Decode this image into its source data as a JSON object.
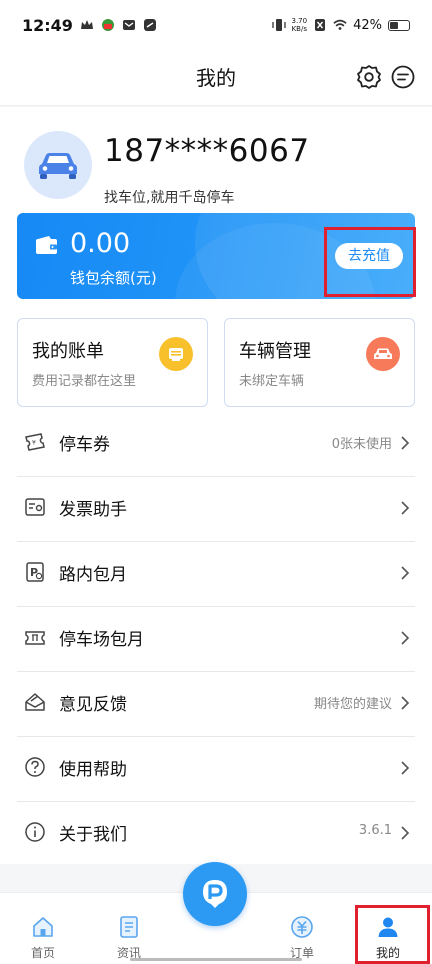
{
  "status_bar": {
    "time": "12:49",
    "net_speed_value": "3.70",
    "net_speed_unit": "KB/s",
    "battery": "42%"
  },
  "header": {
    "title": "我的",
    "settings_icon": "gear-icon",
    "message_icon": "message-icon"
  },
  "profile": {
    "phone": "187****6067",
    "slogan": "找车位,就用千岛停车"
  },
  "wallet": {
    "balance": "0.00",
    "balance_label": "钱包余额(元)",
    "recharge_label": "去充值",
    "accent": "#1d8cf5"
  },
  "quick_cards": [
    {
      "title": "我的账单",
      "subtitle": "费用记录都在这里",
      "icon": "bill-icon"
    },
    {
      "title": "车辆管理",
      "subtitle": "未绑定车辆",
      "icon": "car-icon"
    }
  ],
  "menu": [
    {
      "label": "停车券",
      "value": "0张未使用",
      "icon": "coupon-icon"
    },
    {
      "label": "发票助手",
      "value": "",
      "icon": "invoice-icon"
    },
    {
      "label": "路内包月",
      "value": "",
      "icon": "street-parking-icon"
    },
    {
      "label": "停车场包月",
      "value": "",
      "icon": "parking-lot-icon"
    },
    {
      "label": "意见反馈",
      "value": "期待您的建议",
      "icon": "feedback-icon"
    },
    {
      "label": "使用帮助",
      "value": "",
      "icon": "help-icon"
    },
    {
      "label": "关于我们",
      "value": "3.6.1",
      "icon": "info-icon"
    }
  ],
  "bottom_nav": [
    {
      "label": "首页",
      "icon": "home-icon"
    },
    {
      "label": "资讯",
      "icon": "news-icon"
    },
    {
      "label": "订单",
      "icon": "order-icon"
    },
    {
      "label": "我的",
      "icon": "user-icon"
    }
  ]
}
